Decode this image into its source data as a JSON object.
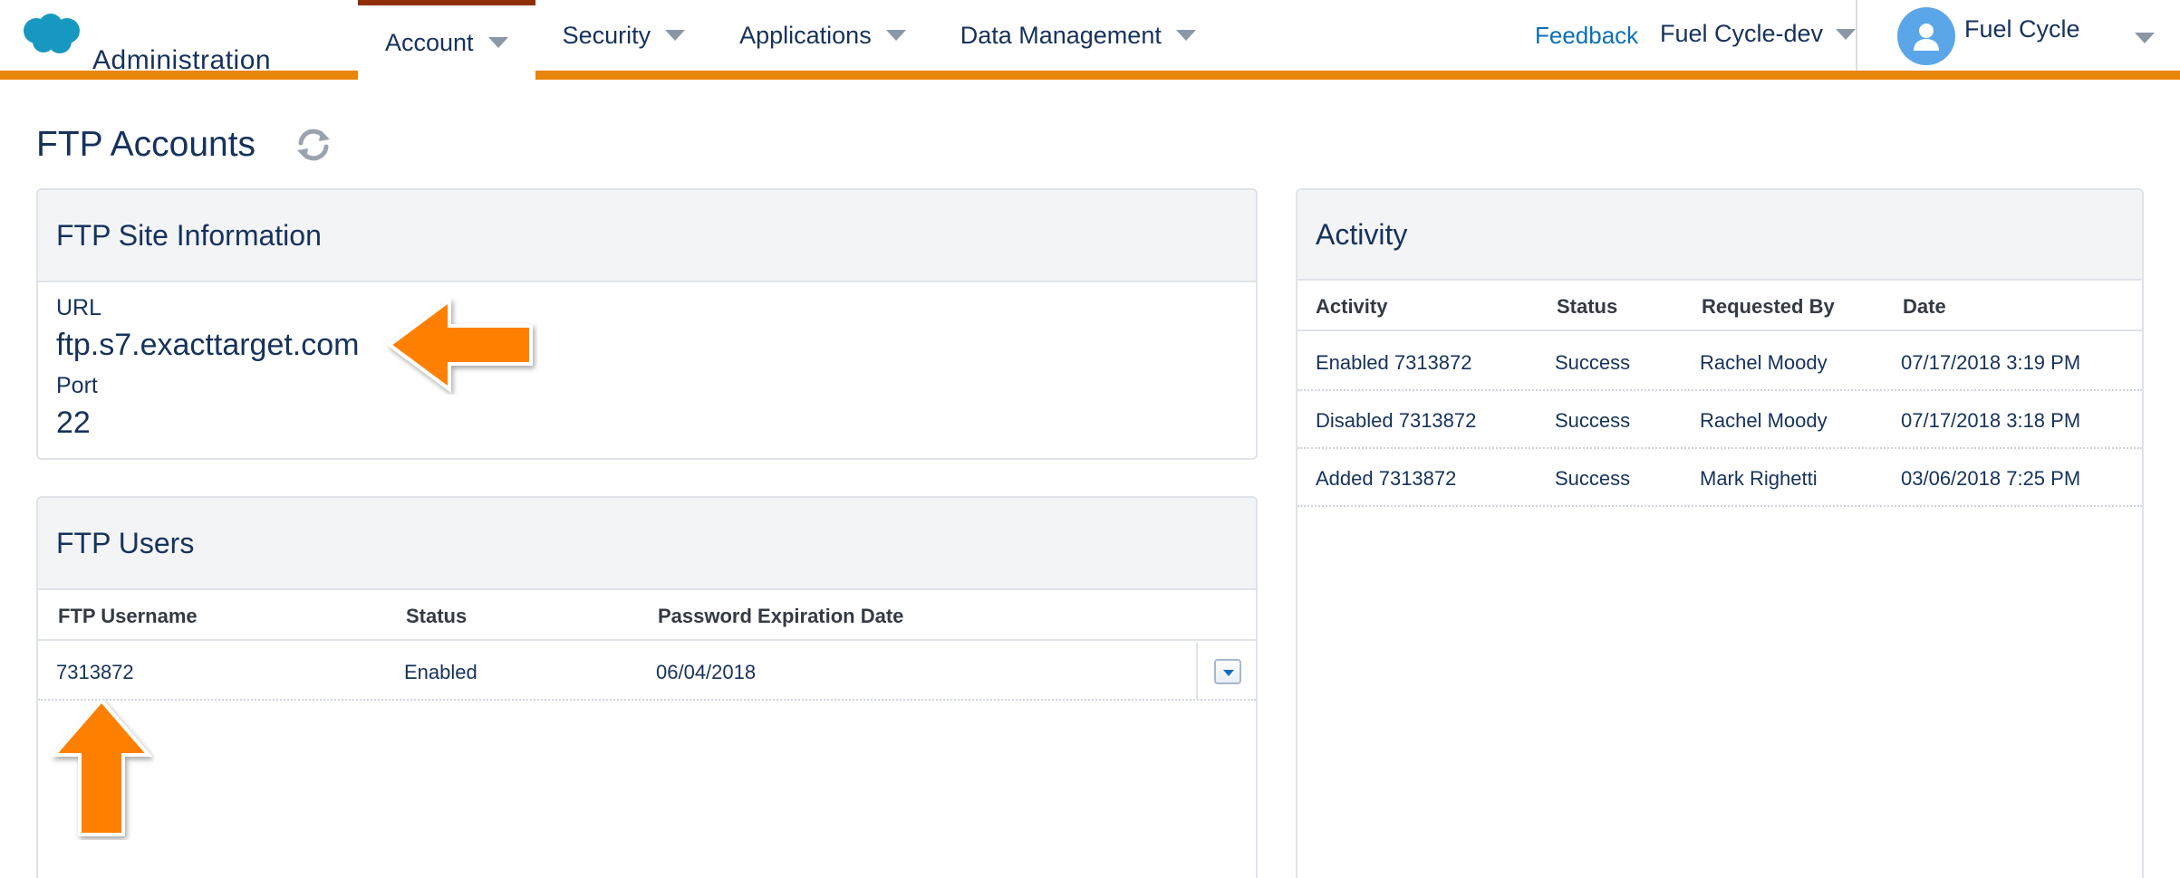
{
  "app": {
    "name": "Administration"
  },
  "nav": [
    {
      "label": "Account",
      "active": true
    },
    {
      "label": "Security",
      "active": false
    },
    {
      "label": "Applications",
      "active": false
    },
    {
      "label": "Data Management",
      "active": false
    }
  ],
  "header": {
    "feedback": "Feedback",
    "tenant": "Fuel Cycle-dev",
    "user": "Fuel Cycle"
  },
  "page": {
    "title": "FTP Accounts"
  },
  "site_info": {
    "title": "FTP Site Information",
    "url_label": "URL",
    "url_value": "ftp.s7.exacttarget.com",
    "port_label": "Port",
    "port_value": "22"
  },
  "ftp_users": {
    "title": "FTP Users",
    "columns": [
      "FTP Username",
      "Status",
      "Password Expiration Date"
    ],
    "rows": [
      {
        "username": "7313872",
        "status": "Enabled",
        "expiration": "06/04/2018"
      }
    ]
  },
  "activity": {
    "title": "Activity",
    "columns": [
      "Activity",
      "Status",
      "Requested By",
      "Date"
    ],
    "rows": [
      {
        "activity": "Enabled 7313872",
        "status": "Success",
        "requested_by": "Rachel Moody",
        "date": "07/17/2018 3:19 PM"
      },
      {
        "activity": "Disabled 7313872",
        "status": "Success",
        "requested_by": "Rachel Moody",
        "date": "07/17/2018 3:18 PM"
      },
      {
        "activity": "Added 7313872",
        "status": "Success",
        "requested_by": "Mark Righetti",
        "date": "03/06/2018 7:25 PM"
      }
    ]
  },
  "colors": {
    "accent": "#e8850c",
    "active_tab": "#8f2f08",
    "link": "#0b6fba",
    "text": "#16325c",
    "annotation": "#ff8000"
  },
  "icons": {
    "logo": "salesforce-cloud-logo",
    "refresh": "refresh-icon",
    "avatar": "user-avatar-icon",
    "row_menu": "chevron-down-icon"
  }
}
